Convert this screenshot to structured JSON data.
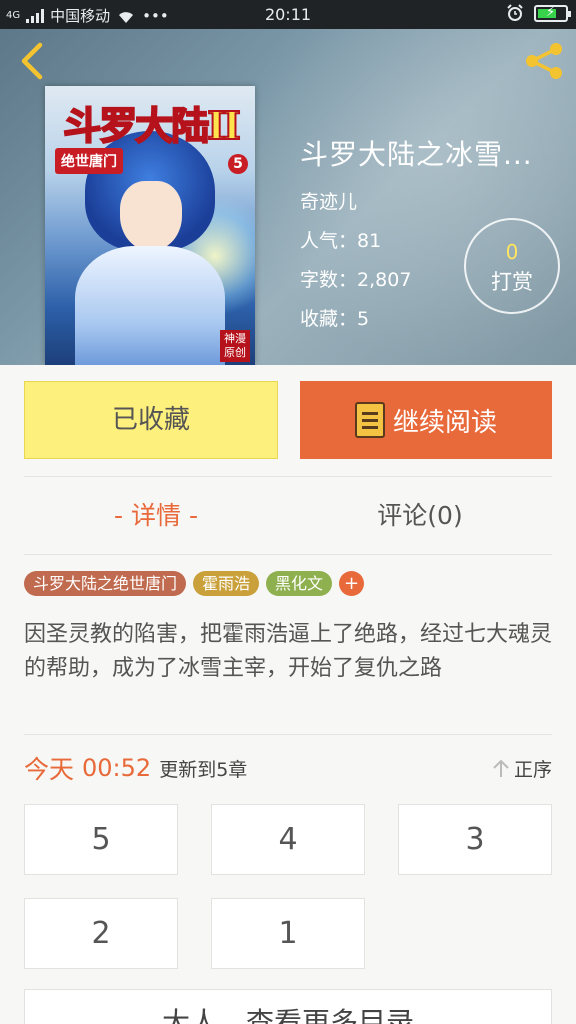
{
  "status_bar": {
    "carrier": "中国移动",
    "network": "4G",
    "time": "20:11",
    "more": "•••",
    "battery_level": 0.7,
    "colors": {
      "background": "#1f2326",
      "battery": "#38d14b"
    }
  },
  "book": {
    "title": "斗罗大陆之冰雪...",
    "author": "奇迹儿",
    "stats": [
      {
        "label": "人气：",
        "value": "81"
      },
      {
        "label": "字数：",
        "value": "2,807"
      },
      {
        "label": "收藏：",
        "value": "5"
      }
    ],
    "reward": {
      "count": "0",
      "label": "打赏"
    },
    "cover": {
      "logo": "斗罗大陆II",
      "subtitle": "绝世唐门",
      "volume": "5",
      "stamp": "神漫原创"
    }
  },
  "actions": {
    "favorited_label": "已收藏",
    "continue_label": "继续阅读",
    "colors": {
      "favorited": "#fef07d",
      "continue": "#e8693a"
    }
  },
  "tabs": [
    {
      "label": "- 详情 -",
      "active": true
    },
    {
      "label": "评论(0)",
      "active": false
    }
  ],
  "tags": [
    {
      "label": "斗罗大陆之绝世唐门",
      "color": "#c06a4f"
    },
    {
      "label": "霍雨浩",
      "color": "#c9a03a"
    },
    {
      "label": "黑化文",
      "color": "#8fb04e"
    }
  ],
  "tag_add_label": "+",
  "description": "因圣灵教的陷害，把霍雨浩逼上了绝路，经过七大魂灵的帮助，成为了冰雪主宰，开始了复仇之路",
  "update": {
    "day": "今天",
    "time": "00:52",
    "info": "更新到5章",
    "order_label": "正序"
  },
  "chapters": [
    "5",
    "4",
    "3",
    "2",
    "1"
  ],
  "more_label": "大人，查看更多目录"
}
